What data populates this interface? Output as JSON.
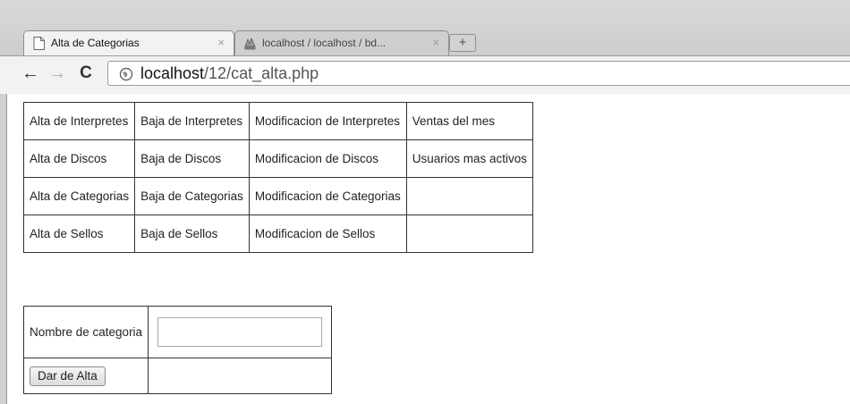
{
  "browser": {
    "tabs": [
      {
        "title": "Alta de Categorias",
        "close": "×",
        "icon": "page-icon"
      },
      {
        "title": "localhost / localhost / bd...",
        "close": "×",
        "icon": "phpmyadmin-icon"
      }
    ],
    "new_tab": "+",
    "nav": {
      "back": "←",
      "forward": "→",
      "reload": "C"
    },
    "url": {
      "host": "localhost",
      "path": "/12/cat_alta.php"
    }
  },
  "menu": {
    "rows": [
      [
        "Alta de Interpretes",
        "Baja de Interpretes",
        "Modificacion de Interpretes",
        "Ventas del mes"
      ],
      [
        "Alta de Discos",
        "Baja de Discos",
        "Modificacion de Discos",
        "Usuarios mas activos"
      ],
      [
        "Alta de Categorias",
        "Baja de Categorias",
        "Modificacion de Categorias",
        ""
      ],
      [
        "Alta de Sellos",
        "Baja de Sellos",
        "Modificacion de Sellos",
        ""
      ]
    ]
  },
  "form": {
    "label": "Nombre de categoria",
    "input_value": "",
    "submit_label": "Dar de Alta"
  }
}
